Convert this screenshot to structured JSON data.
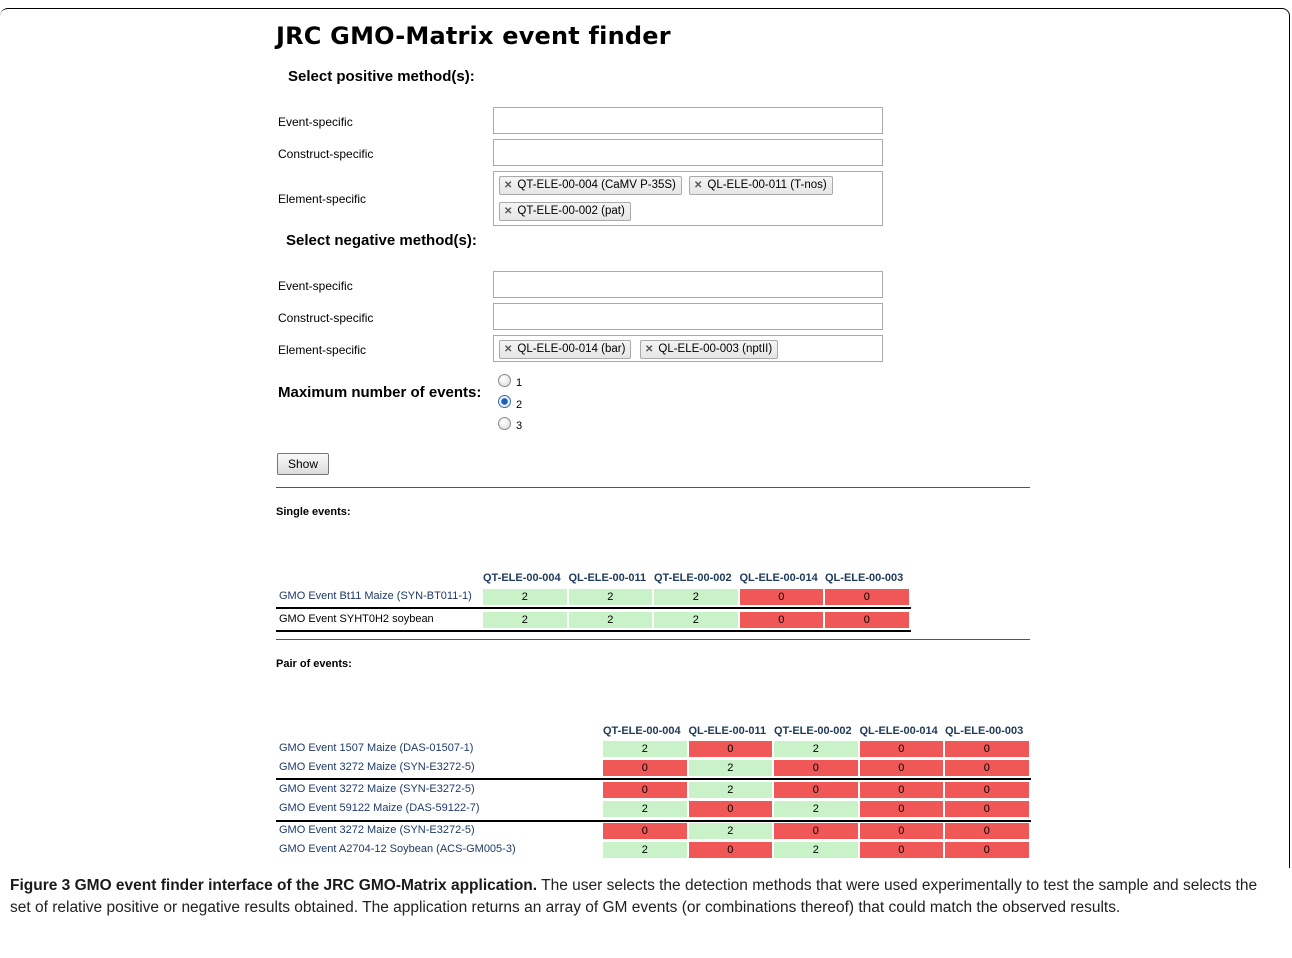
{
  "app": {
    "title": "JRC GMO-Matrix event finder"
  },
  "positive": {
    "heading": "Select positive method(s):",
    "event_label": "Event-specific",
    "construct_label": "Construct-specific",
    "element_label": "Element-specific",
    "element_chips": [
      "QT-ELE-00-004 (CaMV P-35S)",
      "QL-ELE-00-011 (T-nos)",
      "QT-ELE-00-002 (pat)"
    ]
  },
  "negative": {
    "heading": "Select negative method(s):",
    "event_label": "Event-specific",
    "construct_label": "Construct-specific",
    "element_label": "Element-specific",
    "element_chips": [
      "QL-ELE-00-014 (bar)",
      "QL-ELE-00-003 (nptII)"
    ]
  },
  "max_events": {
    "label": "Maximum number of events:",
    "options": [
      "1",
      "2",
      "3"
    ],
    "selected": "2"
  },
  "show_button": "Show",
  "single": {
    "heading": "Single events:",
    "columns": [
      "QT-ELE-00-004",
      "QL-ELE-00-011",
      "QT-ELE-00-002",
      "QL-ELE-00-014",
      "QL-ELE-00-003"
    ],
    "rows": [
      {
        "label": "GMO Event Bt11 Maize (SYN-BT011-1)",
        "values": [
          "2",
          "2",
          "2",
          "0",
          "0"
        ]
      },
      {
        "label": "GMO Event SYHT0H2 soybean",
        "values": [
          "2",
          "2",
          "2",
          "0",
          "0"
        ]
      }
    ]
  },
  "pairs": {
    "heading": "Pair of events:",
    "columns": [
      "QT-ELE-00-004",
      "QL-ELE-00-011",
      "QT-ELE-00-002",
      "QL-ELE-00-014",
      "QL-ELE-00-003"
    ],
    "rows": [
      {
        "label": "GMO Event 1507 Maize (DAS-01507-1)",
        "values": [
          "2",
          "0",
          "2",
          "0",
          "0"
        ]
      },
      {
        "label": "GMO Event 3272 Maize (SYN-E3272-5)",
        "values": [
          "0",
          "2",
          "0",
          "0",
          "0"
        ]
      },
      {
        "label": "GMO Event 3272 Maize (SYN-E3272-5)",
        "values": [
          "0",
          "2",
          "0",
          "0",
          "0"
        ]
      },
      {
        "label": "GMO Event 59122 Maize (DAS-59122-7)",
        "values": [
          "2",
          "0",
          "2",
          "0",
          "0"
        ]
      },
      {
        "label": "GMO Event 3272 Maize (SYN-E3272-5)",
        "values": [
          "0",
          "2",
          "0",
          "0",
          "0"
        ]
      },
      {
        "label": "GMO Event A2704-12 Soybean (ACS-GM005-3)",
        "values": [
          "2",
          "0",
          "2",
          "0",
          "0"
        ]
      }
    ]
  },
  "caption": {
    "bold": "Figure 3 GMO event finder interface of the JRC GMO-Matrix application.",
    "text": " The user selects the detection methods that were used experimentally to test the sample and selects the set of relative positive or negative results obtained. The application returns an array of GM events (or combinations thereof) that could match the observed results."
  }
}
